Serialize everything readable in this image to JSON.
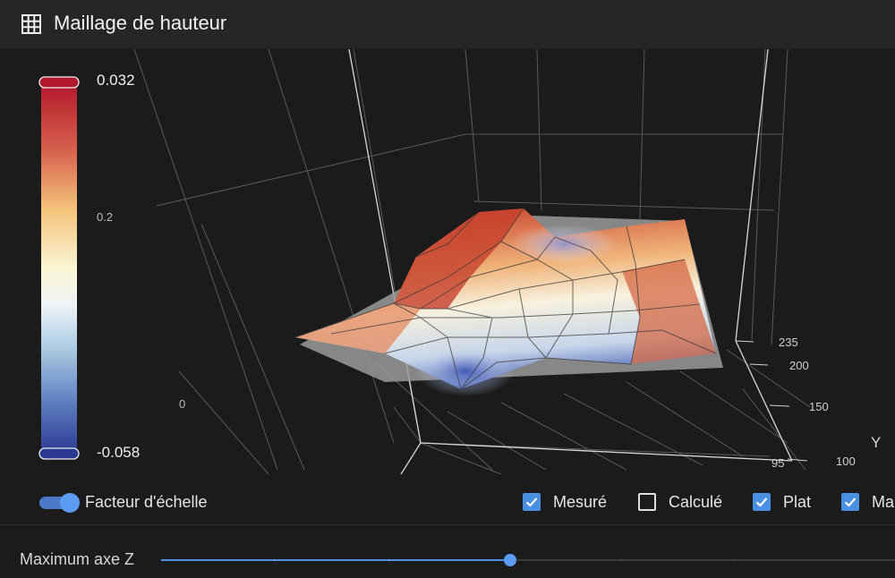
{
  "header": {
    "title": "Maillage de hauteur",
    "icon": "grid-icon"
  },
  "plot": {
    "colorbar": {
      "max_label": "0.032",
      "mid_label": "0.2",
      "min_label": "-0.058",
      "colors": [
        "#b2182b",
        "#d6604d",
        "#f4a582",
        "#fddbc7",
        "#f7f7f7",
        "#d1e5f0",
        "#92c5de",
        "#4393c3",
        "#2166ac"
      ]
    },
    "axis": {
      "zero_label": "0",
      "y_title": "Y",
      "y_ticks": [
        "235",
        "200",
        "150",
        "100",
        "95"
      ]
    }
  },
  "controls": {
    "scale_toggle_label": "Facteur d'échelle",
    "scale_toggle_on": true,
    "checkboxes": [
      {
        "label": "Mesuré",
        "checked": true
      },
      {
        "label": "Calculé",
        "checked": false
      },
      {
        "label": "Plat",
        "checked": true
      },
      {
        "label": "Ma",
        "checked": true
      }
    ]
  },
  "slider": {
    "label": "Maximum axe Z",
    "value_fraction": 0.475
  },
  "colors": {
    "accent": "#4a90e2",
    "background": "#1b1b1b",
    "header_bg": "#262626"
  }
}
